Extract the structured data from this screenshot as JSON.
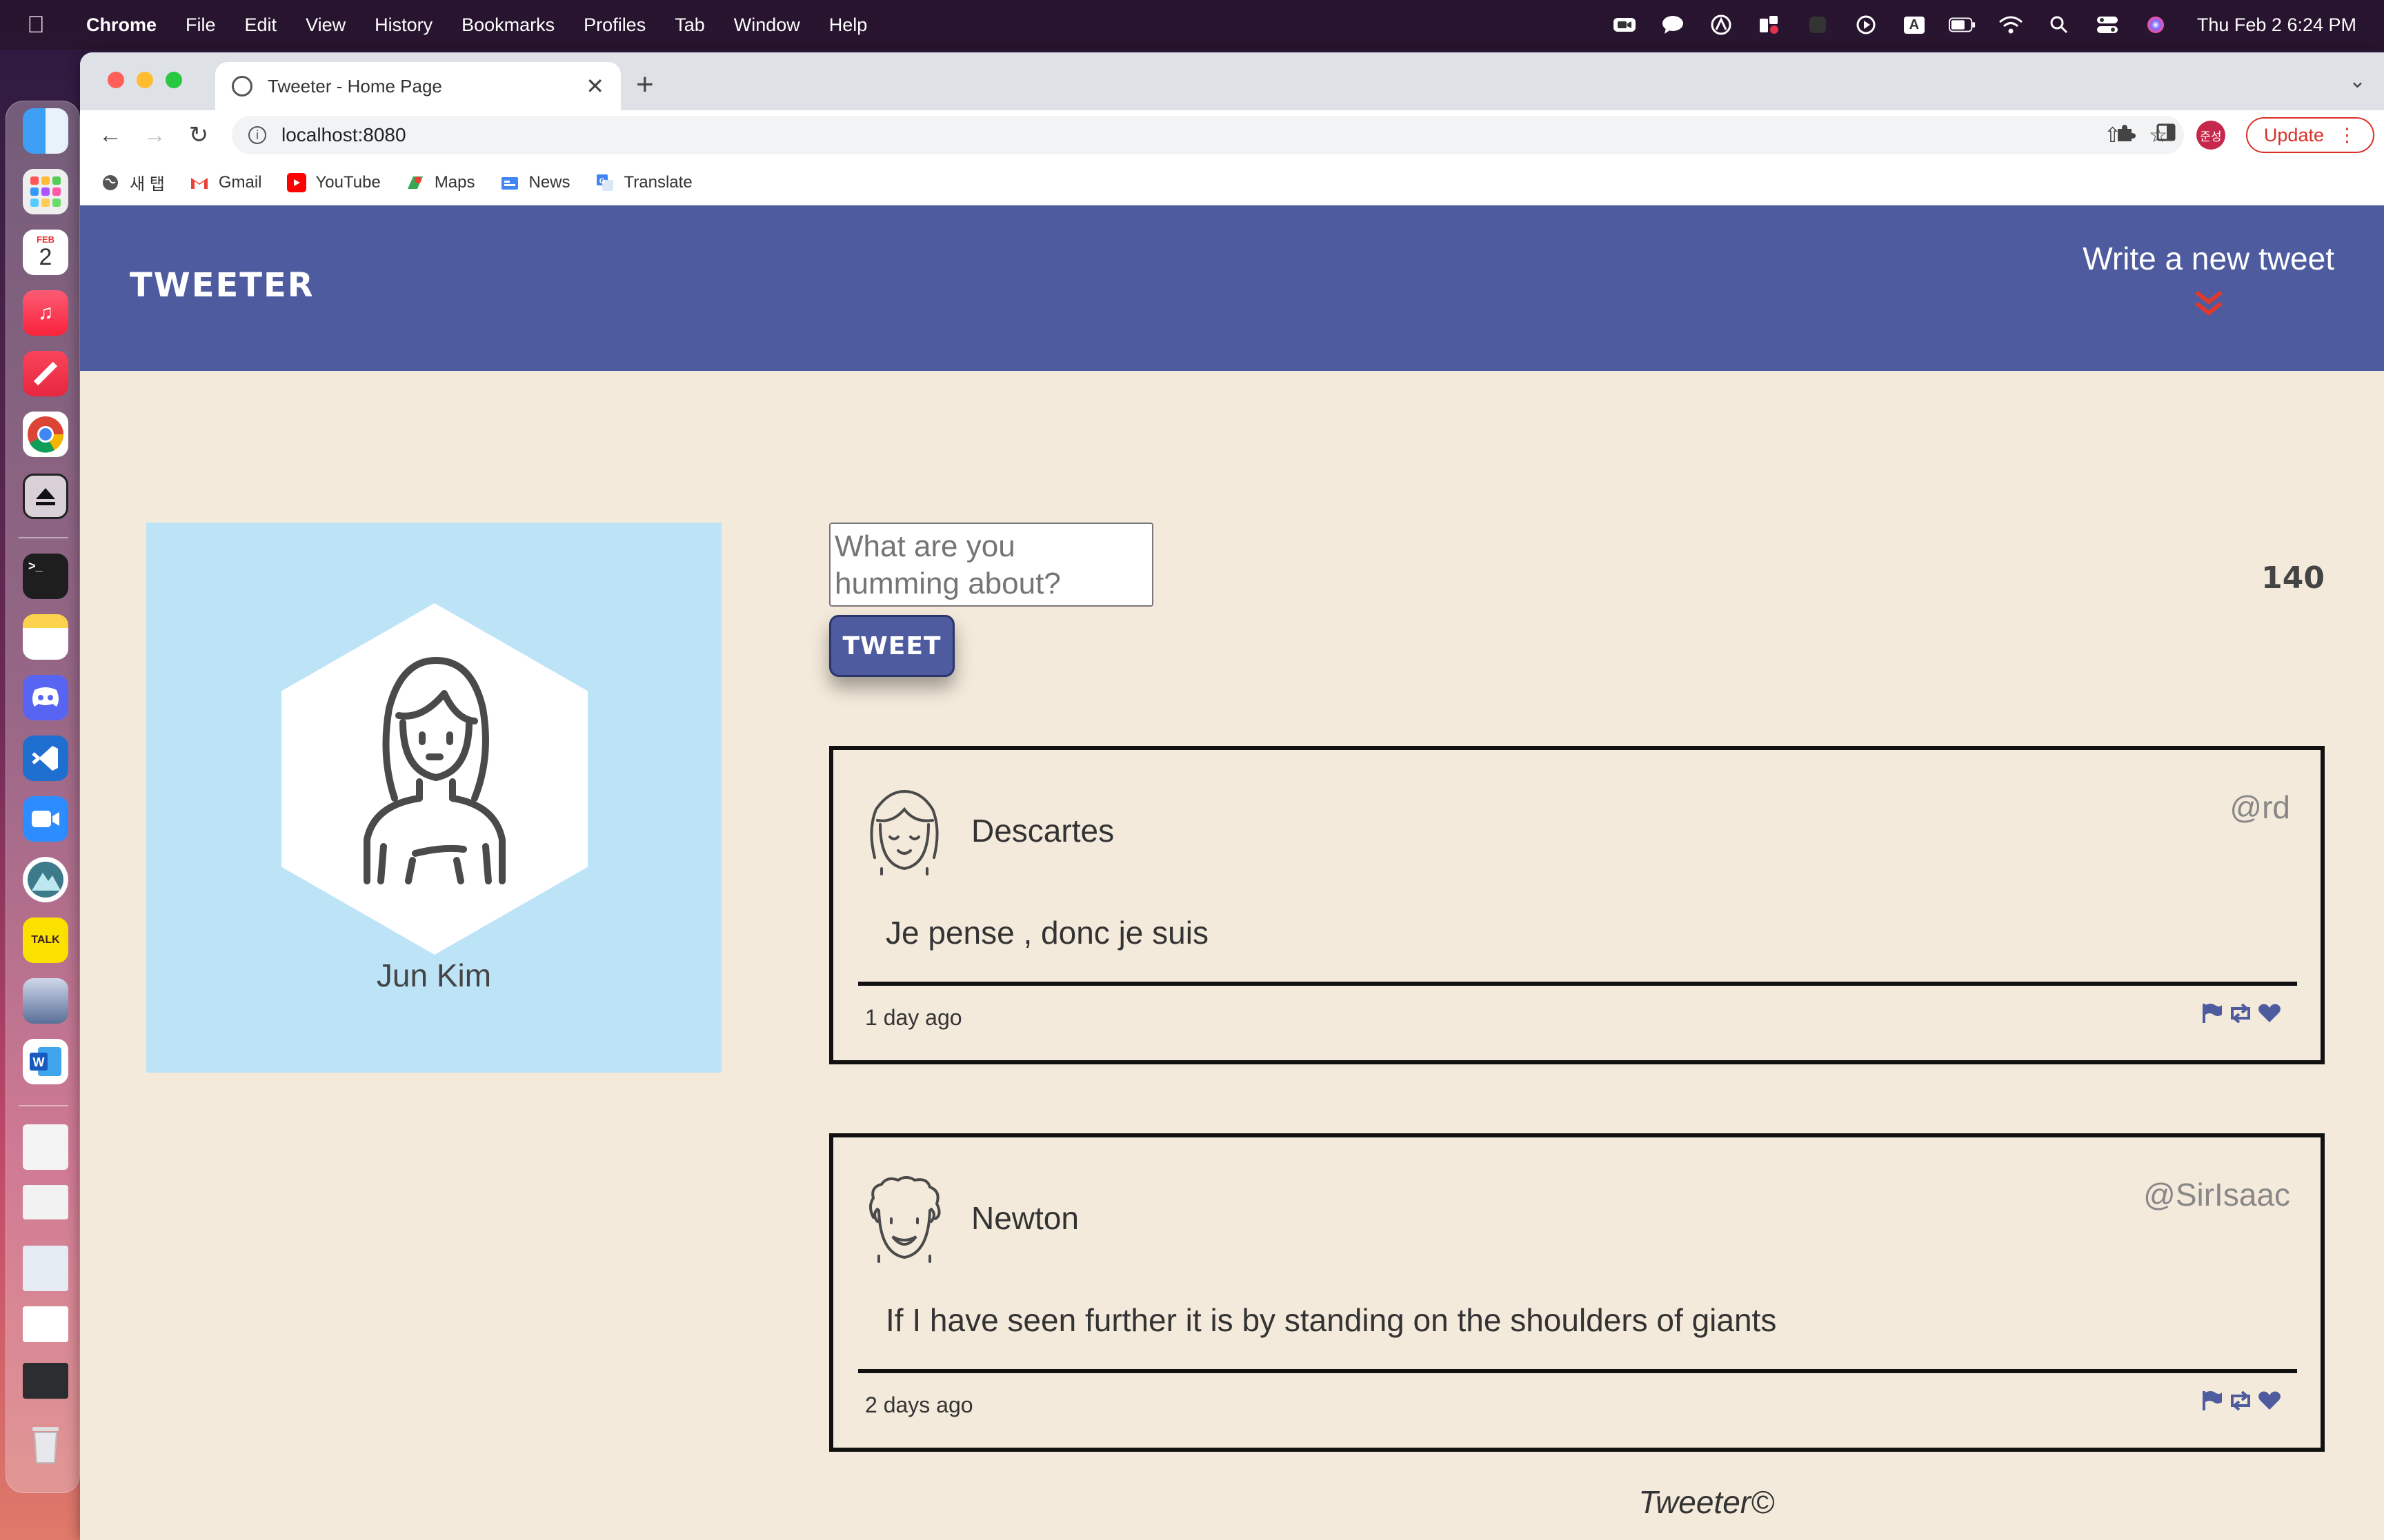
{
  "menubar": {
    "app_name": "Chrome",
    "items": [
      "File",
      "Edit",
      "View",
      "History",
      "Bookmarks",
      "Profiles",
      "Tab",
      "Window",
      "Help"
    ],
    "clock": "Thu Feb 2  6:24 PM",
    "input_source": "A"
  },
  "dock": {
    "calendar_month": "FEB",
    "calendar_day": "2",
    "kakao_label": "TALK"
  },
  "browser": {
    "tab_title": "Tweeter - Home Page",
    "url": "localhost:8080",
    "profile_initials": "준성",
    "update_label": "Update",
    "bookmarks": [
      {
        "label": "새 탭",
        "icon": "globe-icon"
      },
      {
        "label": "Gmail",
        "icon": "gmail-icon"
      },
      {
        "label": "YouTube",
        "icon": "youtube-icon"
      },
      {
        "label": "Maps",
        "icon": "maps-icon"
      },
      {
        "label": "News",
        "icon": "news-icon"
      },
      {
        "label": "Translate",
        "icon": "translate-icon"
      }
    ]
  },
  "site": {
    "brand": "TWEETER",
    "write_new": "Write a new tweet",
    "profile_name": "Jun Kim",
    "composer": {
      "placeholder": "What are you humming about?",
      "button": "TWEET",
      "counter": "140"
    },
    "tweets": [
      {
        "name": "Descartes",
        "handle": "@rd",
        "content": "Je pense , donc je suis",
        "age": "1 day ago"
      },
      {
        "name": "Newton",
        "handle": "@SirIsaac",
        "content": "If I have seen further it is by standing on the shoulders of giants",
        "age": "2 days ago"
      }
    ],
    "footer": "Tweeter©"
  },
  "colors": {
    "nav_bg": "#4f5b9f",
    "page_bg": "#f4eadb",
    "profile_bg": "#bde3f7",
    "accent_red": "#e0392b",
    "action_icon": "#4f5b9f"
  }
}
